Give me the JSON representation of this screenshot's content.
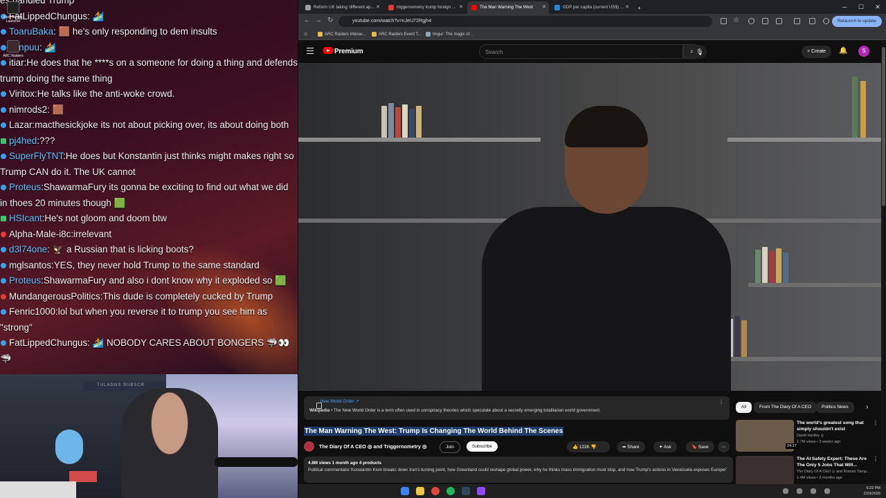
{
  "chat": {
    "messages": [
      {
        "user": "",
        "color": "#f0f0f0",
        "dot": "",
        "text": "es handled Trump"
      },
      {
        "user": "FatLippedChungus",
        "color": "#f0f0f0",
        "dot": "blue",
        "text": ": 🏄"
      },
      {
        "user": "ToaruBaka",
        "color": "#5dc1ff",
        "dot": "blue",
        "text": ": 🟫 he's only responding to dem insults"
      },
      {
        "user": "hknpuu",
        "color": "#5dc1ff",
        "dot": "blue",
        "text": ": 🏄"
      },
      {
        "user": "itiar",
        "color": "#f0f0f0",
        "dot": "blue",
        "text": ":He does that he ****s on a someone for doing a thing and defends trump doing the same thing"
      },
      {
        "user": "Viritox",
        "color": "#f0f0f0",
        "dot": "blue",
        "text": ":He talks like the anti-woke crowd."
      },
      {
        "user": "nimrods2",
        "color": "#f0f0f0",
        "dot": "blue",
        "text": ": 🟫"
      },
      {
        "user": "Lazar",
        "color": "#f0f0f0",
        "dot": "blue",
        "text": ":macthesickjoke its not about picking over, its about doing both"
      },
      {
        "user": "pj4hed",
        "color": "#5dc1ff",
        "dot": "green",
        "text": ":???"
      },
      {
        "user": "SuperFlyTNT",
        "color": "#5dc1ff",
        "dot": "blue",
        "text": ":He does but Konstantin just thinks might makes right so Trump CAN do it. The UK cannot"
      },
      {
        "user": "Proteus",
        "color": "#5dc1ff",
        "dot": "blue",
        "text": ":ShawarmaFury its gonna be exciting to find out what we did in thoes 20 minutes though 🟩"
      },
      {
        "user": "HSIcant",
        "color": "#5dc1ff",
        "dot": "green",
        "text": ":He's not gloom and doom btw"
      },
      {
        "user": "Alpha-Male-i8c",
        "color": "#f0f0f0",
        "dot": "red",
        "text": ":irrelevant"
      },
      {
        "user": "d3l74one",
        "color": "#5dc1ff",
        "dot": "blue",
        "text": ": 🦅 a Russian that is licking boots?"
      },
      {
        "user": "mglsantos",
        "color": "#f0f0f0",
        "dot": "blue",
        "text": ":YES, they never hold Trump to the same standard"
      },
      {
        "user": "Proteus",
        "color": "#5dc1ff",
        "dot": "blue",
        "text": ":ShawarmaFury and also i dont know why it exploded so 🟩"
      },
      {
        "user": "MundangerousPolitics",
        "color": "#f0f0f0",
        "dot": "red",
        "text": ":This dude is completely cucked by Trump"
      },
      {
        "user": "Fenric1000",
        "color": "#f0f0f0",
        "dot": "blue",
        "text": ":lol but when you reverse it to trump you see him as \"strong\""
      },
      {
        "user": "FatLippedChungus",
        "color": "#f0f0f0",
        "dot": "blue",
        "text": ": 🏄 NOBODY CARES ABOUT BONGERS 🦈👀🦈"
      }
    ]
  },
  "desktop": {
    "icons": [
      {
        "name": "epic-games-icon",
        "label": "Epic Games Launcher"
      },
      {
        "name": "arc-raiders-icon",
        "label": "ARC Raiders"
      }
    ]
  },
  "webcam": {
    "sign": "TULAGNS SUBSCR"
  },
  "browser": {
    "tabs": [
      {
        "label": "Reform UK taking 'different ap...",
        "fav": "#9aa0a6"
      },
      {
        "label": "triggernometry trump foreign ...",
        "fav": "#e53935"
      },
      {
        "label": "The Man Warning The West",
        "fav": "#ff0000"
      },
      {
        "label": "GDP per capita (current US$) ...",
        "fav": "#1e88e5"
      }
    ],
    "url": "youtube.com/watch?v=nJeU72Rgjh4",
    "relaunch": "Relaunch to update",
    "bookmarks": [
      "ARC Raiders Interac...",
      "ARC Raiders Event T...",
      "Imgur: The magic of..."
    ]
  },
  "youtube": {
    "logo": "Premium",
    "search_placeholder": "Search",
    "create_label": "Create",
    "avatar_letter": "S",
    "infocard": {
      "topic": "New World Order ↗",
      "source": "Wikipedia",
      "text": " • The New World Order is a term often used in conspiracy theories which speculate about a secretly emerging totalitarian world government."
    },
    "title": "The Man Warning The West: Trump Is Changing The World Behind The Scenes",
    "channel": "The Diary Of A CEO ◎ and Triggernometry ◎",
    "join": "Join",
    "subscribe": "Subscribe",
    "likes": "122K",
    "share": "Share",
    "ask": "Ask",
    "save": "Save",
    "desc_stats": "4.8M views  1 month ago  4 products",
    "desc_text": "Political commentator Konstantin Kisin breaks down Iran's turning point, how Greenland could reshape global power, why he thinks mass immigration must stop, and how Trump's actions in Venezuela exposes Europe!",
    "chips": [
      "All",
      "From The Diary Of A CEO",
      "Politics News"
    ],
    "recs": [
      {
        "title": "The world's greatest song that simply shouldn't exist",
        "channel": "David Hartley ◎",
        "meta": "1.7M views • 3 weeks ago",
        "dur": "24:17",
        "color": "#6a5a4a"
      },
      {
        "title": "The AI Safety Expert: These Are The Only 5 Jobs That Will...",
        "channel": "The Diary Of A CEO ◎ and Roman Yamp...",
        "meta": "1.4M views • 2 months ago",
        "dur": "",
        "color": "#3a3030"
      }
    ]
  },
  "taskbar": {
    "time": "6:22 PM",
    "date": "2/23/2026"
  }
}
